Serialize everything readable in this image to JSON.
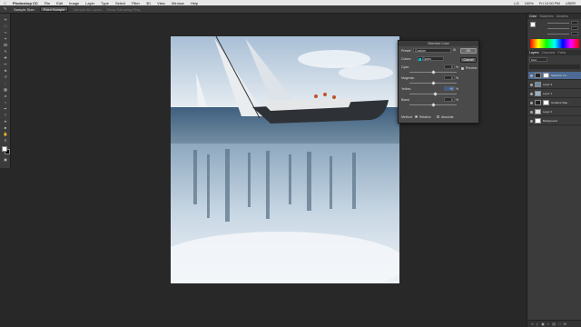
{
  "menubar": {
    "apple": "",
    "app": "Photoshop CC",
    "items": [
      "File",
      "Edit",
      "Image",
      "Layer",
      "Type",
      "Select",
      "Filter",
      "3D",
      "View",
      "Window",
      "Help"
    ],
    "right": [
      "LG",
      "100%",
      "Fri 12:00 PM",
      "USER"
    ]
  },
  "options": {
    "sample_size": "Sample Size:",
    "sample_value": "Point Sample",
    "sample_all": "Sample All Layers",
    "show_ring": "Show Sampling Ring"
  },
  "dialog": {
    "title": "Selective Color",
    "preset_label": "Preset:",
    "preset_value": "Custom",
    "colors_label": "Colors:",
    "colors_value": "Cyans",
    "cyan_label": "Cyan:",
    "cyan_value": "0",
    "magenta_label": "Magenta:",
    "magenta_value": "0",
    "yellow_label": "Yellow:",
    "yellow_value": "+5",
    "black_label": "Black:",
    "black_value": "0",
    "method_label": "Method:",
    "relative_label": "Relative",
    "absolute_label": "Absolute",
    "ok_label": "OK",
    "cancel_label": "Cancel",
    "preview_label": "Preview",
    "unit": "%",
    "slider_levels": {
      "cyan": 0.5,
      "magenta": 0.5,
      "yellow": 0.55,
      "black": 0.5
    }
  },
  "panels": {
    "color_tabs": [
      "Color",
      "Swatches",
      "Libraries"
    ],
    "layer_tabs": [
      "Layers",
      "Channels",
      "Paths"
    ],
    "kind_label": "Kind",
    "layers": [
      {
        "name": "Selective Co..",
        "type": "adj",
        "selected": true
      },
      {
        "name": "Layer 3",
        "type": "img",
        "selected": false
      },
      {
        "name": "Layer 1",
        "type": "img",
        "selected": false
      },
      {
        "name": "Gradient Map..",
        "type": "adj",
        "selected": false
      },
      {
        "name": "Layer 2",
        "type": "img",
        "selected": false
      },
      {
        "name": "Background",
        "type": "img",
        "selected": false
      }
    ]
  },
  "colors": {
    "accent": "#4d6a94",
    "panel": "#3b3b3b",
    "canvas_bg": "#282828"
  },
  "icons": [
    "move-icon",
    "marquee-icon",
    "lasso-icon",
    "quick-select-icon",
    "crop-icon",
    "eyedropper-icon",
    "heal-icon",
    "brush-icon",
    "stamp-icon",
    "history-brush-icon",
    "eraser-icon",
    "gradient-icon",
    "blur-icon",
    "dodge-icon",
    "pen-icon",
    "type-icon",
    "path-select-icon",
    "rectangle-icon",
    "hand-icon",
    "zoom-icon"
  ]
}
